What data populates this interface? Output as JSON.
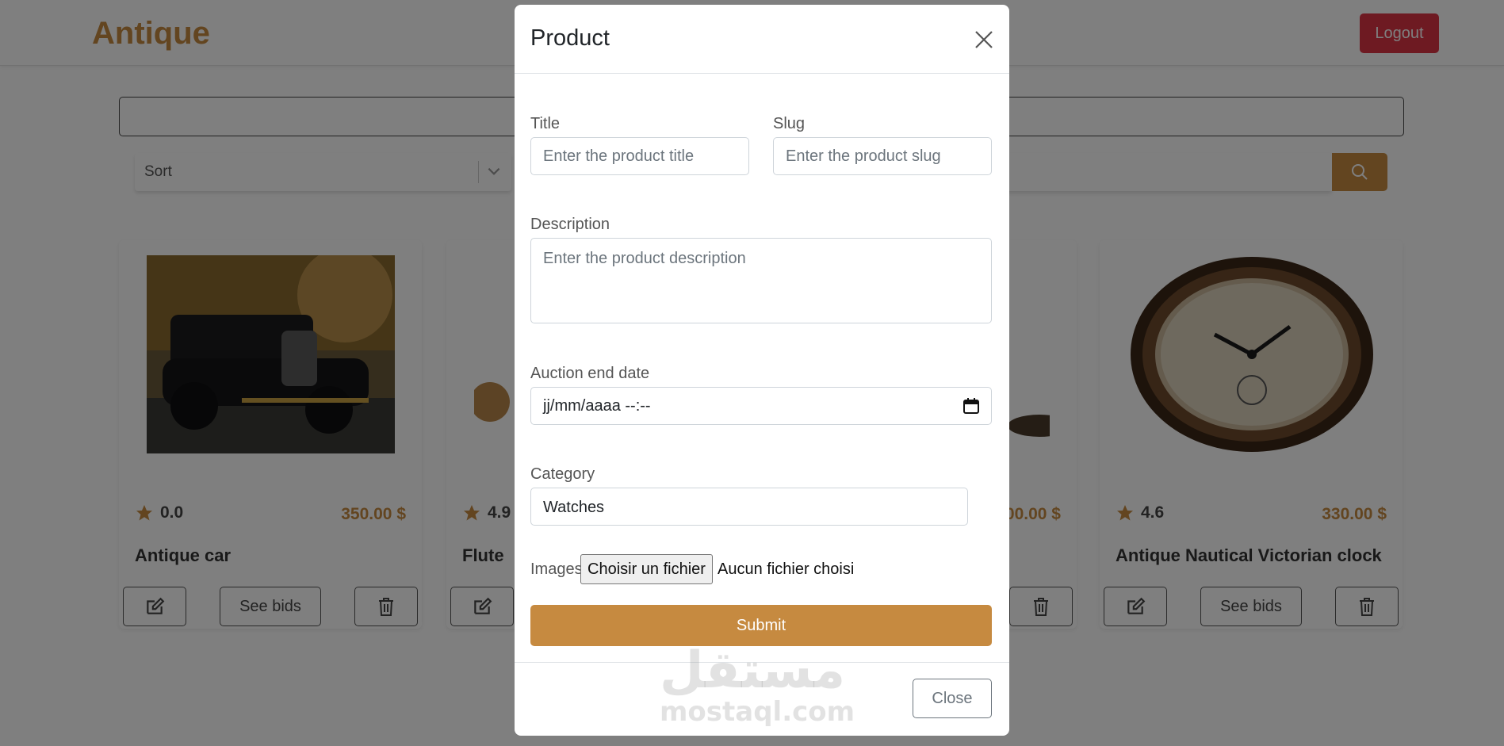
{
  "brand": "Antique",
  "nav": {
    "logout_label": "Logout"
  },
  "filters": {
    "sort_label": "Sort"
  },
  "products": [
    {
      "title": "Antique car",
      "rating": "0.0",
      "price": "350.00 $",
      "bids_label": "See bids"
    },
    {
      "title": "Flute",
      "rating": "4.9"
    },
    {
      "price": "00.00 $"
    },
    {
      "title": "Antique Nautical Victorian clock",
      "rating": "4.6",
      "price": "330.00 $",
      "bids_label": "See bids"
    }
  ],
  "modal": {
    "title": "Product",
    "title_label": "Title",
    "title_placeholder": "Enter the product title",
    "slug_label": "Slug",
    "slug_placeholder": "Enter the product slug",
    "description_label": "Description",
    "description_placeholder": "Enter the product description",
    "auction_label": "Auction end date",
    "auction_value": "jj/mm/aaaa --:--",
    "category_label": "Category",
    "category_value": "Watches",
    "images_label": "Images",
    "file_button": "Choisir un fichier",
    "file_status": "Aucun fichier choisi",
    "submit_label": "Submit",
    "close_label": "Close"
  },
  "watermark": {
    "logo": "مستقل",
    "url": "mostaql.com"
  },
  "colors": {
    "accent": "#c68a40",
    "danger": "#dc3545"
  },
  "icons": [
    "chevron-down-icon",
    "search-icon",
    "star-icon",
    "edit-icon",
    "trash-icon",
    "close-icon",
    "calendar-icon"
  ]
}
